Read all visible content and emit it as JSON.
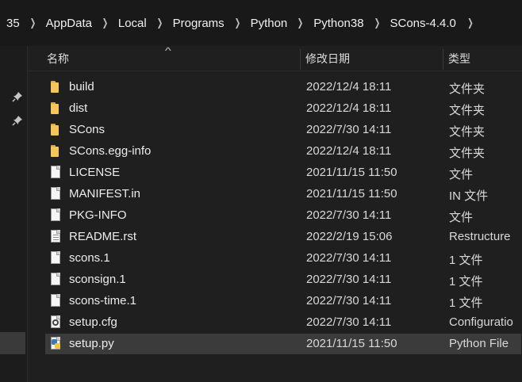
{
  "breadcrumb": {
    "segments": [
      {
        "label": "35"
      },
      {
        "label": "AppData"
      },
      {
        "label": "Local"
      },
      {
        "label": "Programs"
      },
      {
        "label": "Python"
      },
      {
        "label": "Python38"
      },
      {
        "label": "SCons-4.4.0"
      }
    ]
  },
  "columns": {
    "name": "名称",
    "date": "修改日期",
    "type": "类型"
  },
  "files": [
    {
      "name": "build",
      "date": "2022/12/4 18:11",
      "type": "文件夹",
      "icon": "folder-icon"
    },
    {
      "name": "dist",
      "date": "2022/12/4 18:11",
      "type": "文件夹",
      "icon": "folder-icon"
    },
    {
      "name": "SCons",
      "date": "2022/7/30 14:11",
      "type": "文件夹",
      "icon": "folder-icon"
    },
    {
      "name": "SCons.egg-info",
      "date": "2022/12/4 18:11",
      "type": "文件夹",
      "icon": "folder-icon"
    },
    {
      "name": "LICENSE",
      "date": "2021/11/15 11:50",
      "type": "文件",
      "icon": "blank-file-icon"
    },
    {
      "name": "MANIFEST.in",
      "date": "2021/11/15 11:50",
      "type": "IN 文件",
      "icon": "blank-file-icon"
    },
    {
      "name": "PKG-INFO",
      "date": "2022/7/30 14:11",
      "type": "文件",
      "icon": "blank-file-icon"
    },
    {
      "name": "README.rst",
      "date": "2022/2/19 15:06",
      "type": "Restructure",
      "icon": "text-file-icon"
    },
    {
      "name": "scons.1",
      "date": "2022/7/30 14:11",
      "type": "1 文件",
      "icon": "blank-file-icon"
    },
    {
      "name": "sconsign.1",
      "date": "2022/7/30 14:11",
      "type": "1 文件",
      "icon": "blank-file-icon"
    },
    {
      "name": "scons-time.1",
      "date": "2022/7/30 14:11",
      "type": "1 文件",
      "icon": "blank-file-icon"
    },
    {
      "name": "setup.cfg",
      "date": "2022/7/30 14:11",
      "type": "Configuratio",
      "icon": "config-file-icon"
    },
    {
      "name": "setup.py",
      "date": "2021/11/15 11:50",
      "type": "Python File",
      "icon": "python-file-icon",
      "selected": true
    }
  ],
  "colors": {
    "background": "#191919",
    "pane": "#1f1f1f",
    "selected_row": "#3b3b3b",
    "folder": "#f4c55a"
  }
}
